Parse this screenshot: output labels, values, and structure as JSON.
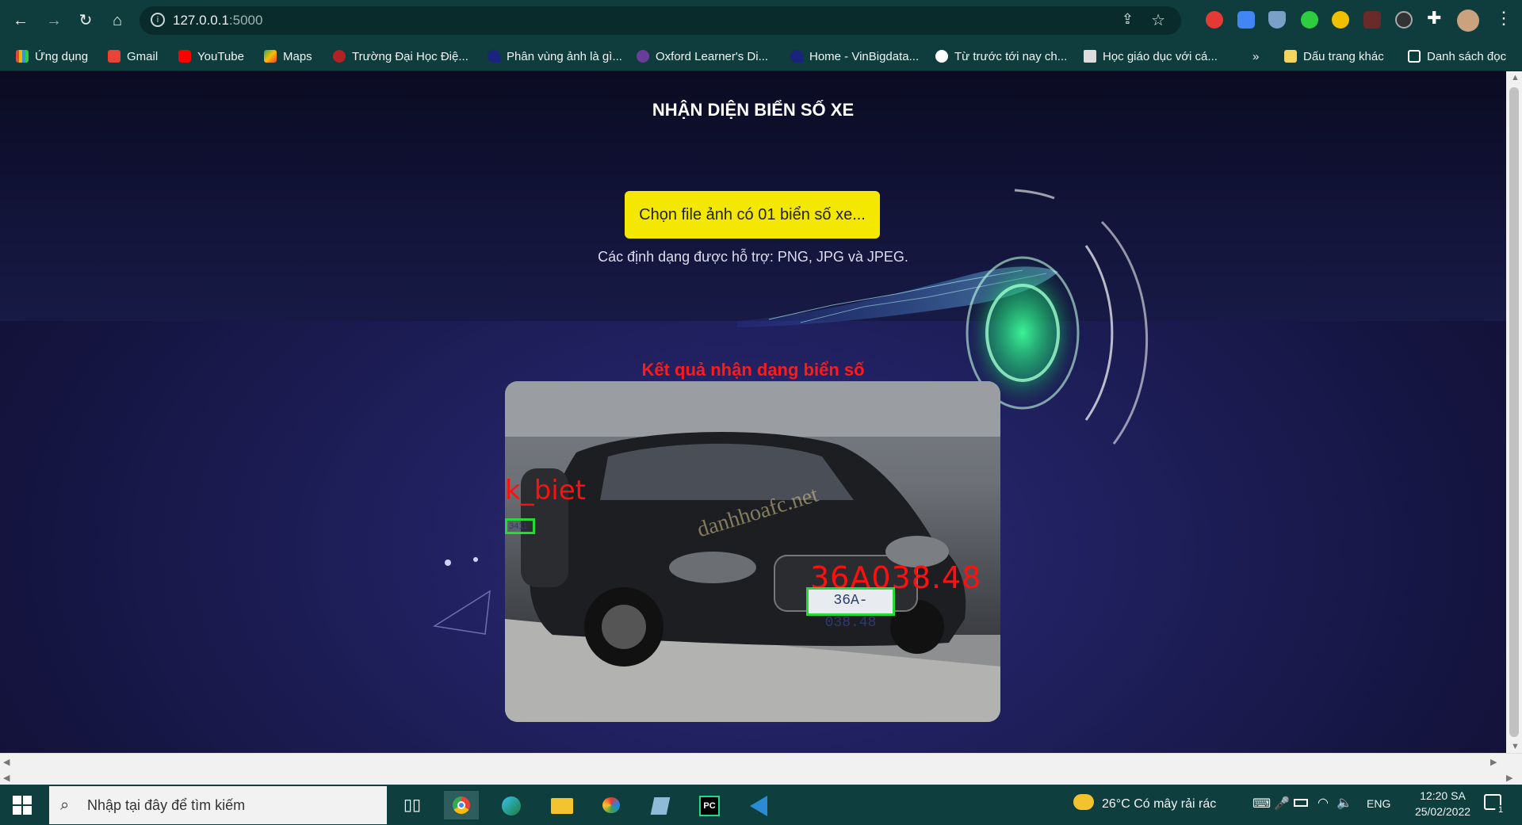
{
  "browser": {
    "url_host": "127.0.0.1",
    "url_port": ":5000",
    "bookmarks": [
      {
        "label": "Ứng dụng",
        "color": "#e04848"
      },
      {
        "label": "Gmail",
        "color": "#ea4335"
      },
      {
        "label": "YouTube",
        "color": "#ff0000"
      },
      {
        "label": "Maps",
        "color": "#34a853"
      },
      {
        "label": "Trường Đại Học Điệ...",
        "color": "#b22222"
      },
      {
        "label": "Phân vùng ảnh là gì...",
        "color": "#1a237e"
      },
      {
        "label": "Oxford Learner's Di...",
        "color": "#6a3d9a"
      },
      {
        "label": "Home - VinBigdata...",
        "color": "#1a237e"
      },
      {
        "label": "Từ trước tới nay ch...",
        "color": "#ffffff"
      },
      {
        "label": "Học giáo dục với cá...",
        "color": "#222222"
      }
    ],
    "overflow": "»",
    "other_bookmarks": "Dấu trang khác",
    "reading_list": "Danh sách đọc"
  },
  "page": {
    "title": "NHẬN DIỆN BIỂN SỐ XE",
    "upload_label": "Chọn file ảnh có 01 biển số xe...",
    "formats": "Các định dạng được hỗ trợ: PNG, JPG và JPEG.",
    "result_title": "Kết quả nhận dạng biển số",
    "image": {
      "label_left": "k_biet",
      "plate_left": "3411",
      "label_main": "36A038.48",
      "plate_main": "36A-038.48",
      "watermark": "danhhoafc.net"
    }
  },
  "taskbar": {
    "search_placeholder": "Nhập tại đây để tìm kiếm",
    "weather": "26°C  Có mây rải rác",
    "lang": "ENG",
    "time": "12:20 SA",
    "date": "25/02/2022",
    "notifications": "1"
  }
}
